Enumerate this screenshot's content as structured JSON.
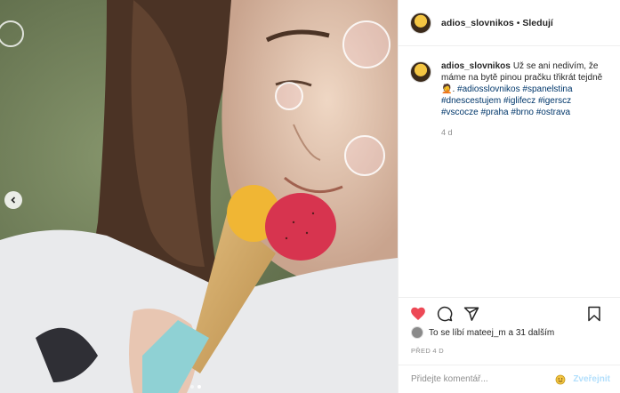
{
  "post": {
    "username": "adios_slovnikos",
    "separator": "•",
    "follow_label": "Sledují",
    "caption_text": "Už se ani nedivím, že máme na bytě pinou pračku třikrát tejdně🤦. ",
    "hashtags": "#adiosslovnikos #spanelstina #dnescestujem #iglifecz #igerscz #vscocze #praha #brno #ostrava",
    "caption_time": "4 d",
    "likes_text": "To se líbí mateej_m a 31 dalším",
    "post_date": "PŘED 4 D",
    "like_state": "liked",
    "accent_color": "#ed4956"
  },
  "comment": {
    "placeholder": "Přidejte komentář...",
    "post_label": "Zveřejnit"
  },
  "carousel": {
    "dots": 2,
    "active_index": 1
  },
  "icons": {
    "prev": "chevron-left-icon",
    "like": "heart-filled-icon",
    "comment": "comment-icon",
    "share": "share-icon",
    "save": "bookmark-icon",
    "emoji": "emoji-icon"
  }
}
